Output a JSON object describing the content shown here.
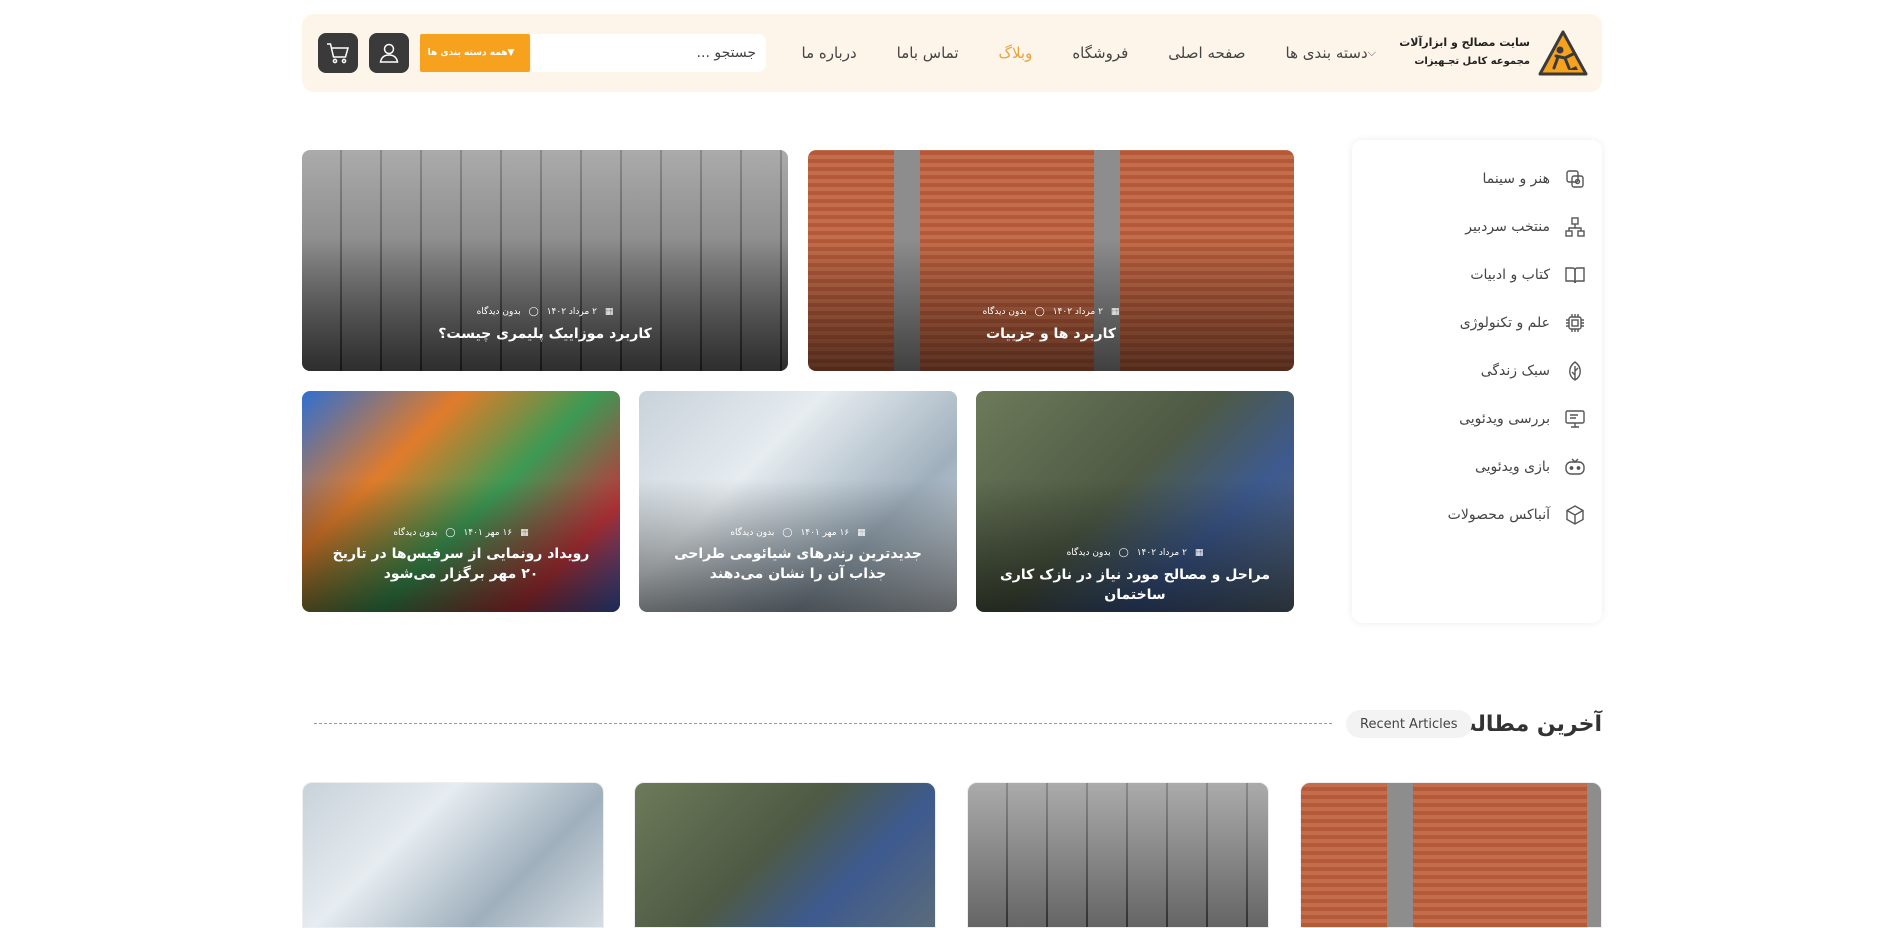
{
  "header": {
    "logo": {
      "title": "سایت مصالح و ابزارآلات",
      "subtitle": "مجموعه کامل تجـهیزات"
    },
    "nav": [
      {
        "label": "دسته بندی ها",
        "dropdown": true
      },
      {
        "label": "صفحه اصلی"
      },
      {
        "label": "فروشگاه"
      },
      {
        "label": "وبلاگ",
        "active": true
      },
      {
        "label": "تماس باما"
      },
      {
        "label": "درباره ما"
      }
    ],
    "search": {
      "placeholder": "جستجو ...",
      "category_label": "همه دسته بندی ها"
    },
    "colors": {
      "accent": "#f6a21e",
      "header_bg": "#fdf5ea",
      "icon_btn": "#3a3a3a",
      "active_nav": "#e8a33c"
    }
  },
  "sidebar": {
    "items": [
      {
        "label": "هنر و سینما",
        "icon": "film-icon"
      },
      {
        "label": "منتخب سردبیر",
        "icon": "network-icon"
      },
      {
        "label": "کتاب و ادبیات",
        "icon": "book-icon"
      },
      {
        "label": "علم و تکنولوژی",
        "icon": "chip-icon"
      },
      {
        "label": "سبک زندگی",
        "icon": "leaf-icon"
      },
      {
        "label": "بررسی ویدئویی",
        "icon": "monitor-icon"
      },
      {
        "label": "بازی ویدئویی",
        "icon": "gamepad-icon"
      },
      {
        "label": "آنباکس محصولات",
        "icon": "box-icon"
      }
    ]
  },
  "featured": [
    {
      "title": "کاربرد ها و جزییات",
      "date": "۲ مرداد ۱۴۰۲",
      "comments": "بدون دیدگاه",
      "image": "brick-facade"
    },
    {
      "title": "کاربرد موزاییک پلیمری چیست؟",
      "date": "۲ مرداد ۱۴۰۲",
      "comments": "بدون دیدگاه",
      "image": "floor-tiles"
    },
    {
      "title": "مراحل و مصالح مورد نیاز در نازک کاری ساختمان",
      "date": "۲ مرداد ۱۴۰۲",
      "comments": "بدون دیدگاه",
      "image": "plastering-workers"
    },
    {
      "title": "جدیدترین رندرهای شیائومی طراحی جذاب آن را نشان می‌دهند",
      "date": "۱۶ مهر ۱۴۰۱",
      "comments": "بدون دیدگاه",
      "image": "silver-phone"
    },
    {
      "title": "رویداد رونمایی از سرفیس‌ها در تاریخ ۲۰ مهر برگزار می‌شود",
      "date": "۱۶ مهر ۱۴۰۱",
      "comments": "بدون دیدگاه",
      "image": "save-the-date"
    }
  ],
  "recent": {
    "title": "آخرین مطالب",
    "badge": "Recent Articles",
    "cards": [
      {
        "image": "brick-facade"
      },
      {
        "image": "floor-tiles"
      },
      {
        "image": "plastering-workers"
      },
      {
        "image": "silver-phone"
      }
    ]
  }
}
